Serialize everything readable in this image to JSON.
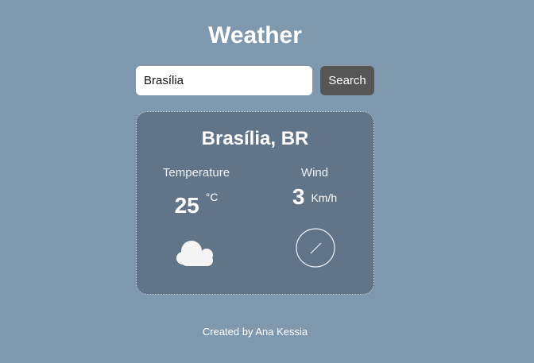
{
  "header": {
    "title": "Weather"
  },
  "search": {
    "value": "Brasília",
    "button_label": "Search"
  },
  "weather": {
    "location": "Brasília, BR",
    "temperature": {
      "label": "Temperature",
      "value": "25",
      "unit": "°C",
      "icon": "cloud-icon"
    },
    "wind": {
      "label": "Wind",
      "value": "3",
      "unit": "Km/h",
      "icon": "wind-direction-icon"
    }
  },
  "footer": {
    "credit": "Created by Ana Kessia"
  },
  "colors": {
    "background": "#7f98ae",
    "card": "#627488",
    "button": "#565656",
    "text": "#ffffff"
  }
}
